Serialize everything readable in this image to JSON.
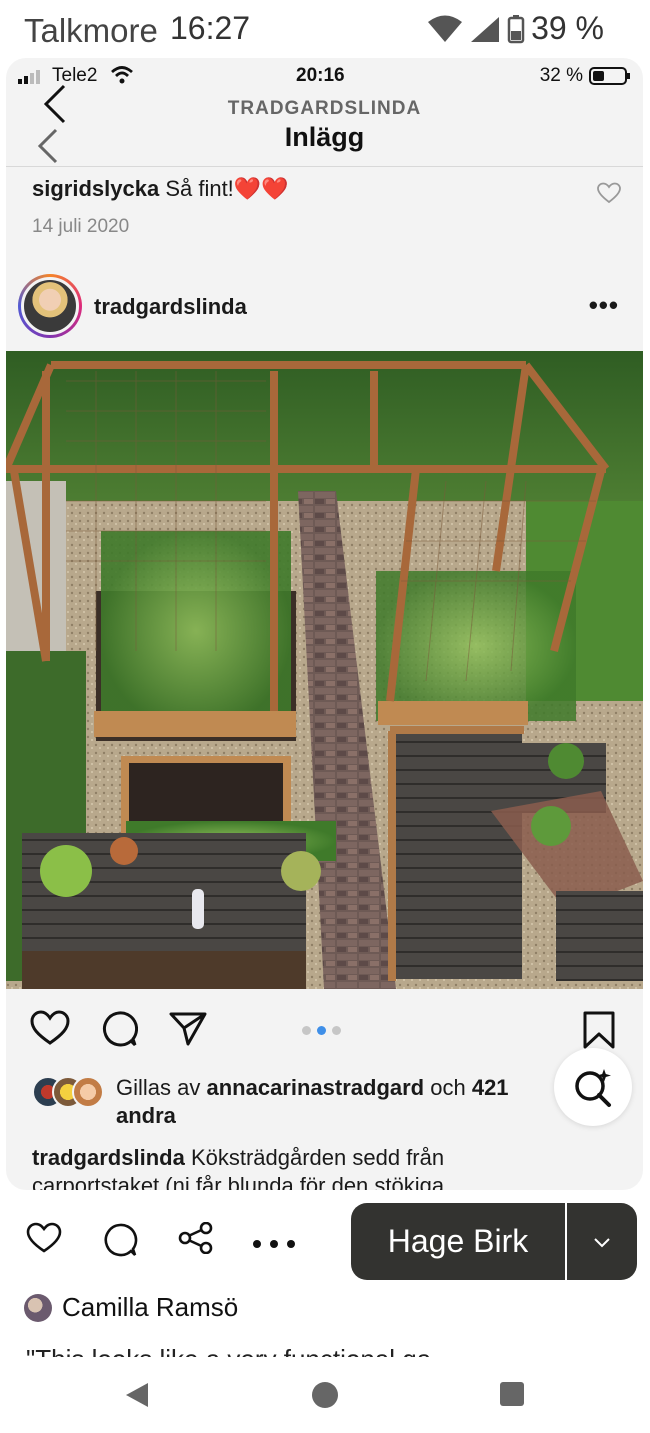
{
  "outer_status": {
    "carrier": "Talkmore",
    "time": "16:27",
    "battery": "39 %"
  },
  "inner_status": {
    "carrier": "Tele2",
    "time": "20:16",
    "battery": "32 %"
  },
  "header": {
    "account": "TRADGARDSLINDA",
    "title": "Inlägg"
  },
  "comment": {
    "user": "sigridslycka",
    "text": "Så fint!❤️❤️",
    "date": "14 juli 2020"
  },
  "post": {
    "author": "tradgardslinda",
    "image_alt": "Köksträdgård med odlingslådor, spaljéer och stenlagd gång",
    "carousel": {
      "count": 3,
      "active": 2
    },
    "likes": {
      "prefix": "Gillas av ",
      "user": "annacarinastradgard",
      "middle": " och ",
      "count": "421",
      "suffix": "andra"
    },
    "caption": {
      "user": "tradgardslinda",
      "text": "Köksträdgården sedd från carportstaket (ni får blunda för den stökiga"
    }
  },
  "save": {
    "board": "Hage Birk"
  },
  "pinner": {
    "name": "Camilla Ramsö"
  },
  "quote": "\"This looks like a very functional ga",
  "colors": {
    "accent": "#3f8fe8",
    "save_bg": "#333330",
    "heart": "#e0243c"
  },
  "icons": [
    "back-icon",
    "heart-icon",
    "comment-icon",
    "share-icon",
    "bookmark-icon",
    "lens-icon",
    "chevron-down-icon",
    "more-icon",
    "back-nav-icon",
    "home-nav-icon",
    "recents-nav-icon"
  ]
}
